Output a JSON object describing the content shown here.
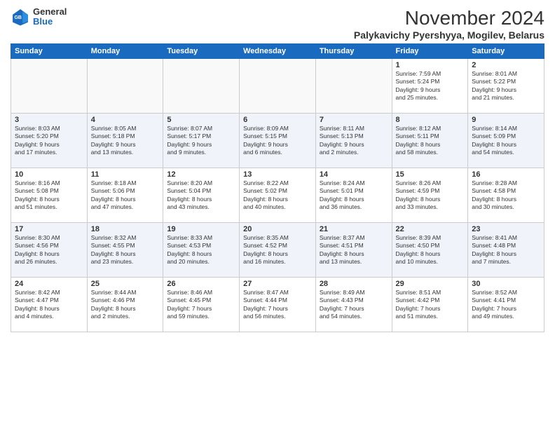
{
  "logo": {
    "general": "General",
    "blue": "Blue"
  },
  "header": {
    "title": "November 2024",
    "subtitle": "Palykavichy Pyershyya, Mogilev, Belarus"
  },
  "weekdays": [
    "Sunday",
    "Monday",
    "Tuesday",
    "Wednesday",
    "Thursday",
    "Friday",
    "Saturday"
  ],
  "weeks": [
    {
      "days": [
        {
          "num": "",
          "info": ""
        },
        {
          "num": "",
          "info": ""
        },
        {
          "num": "",
          "info": ""
        },
        {
          "num": "",
          "info": ""
        },
        {
          "num": "",
          "info": ""
        },
        {
          "num": "1",
          "info": "Sunrise: 7:59 AM\nSunset: 5:24 PM\nDaylight: 9 hours\nand 25 minutes."
        },
        {
          "num": "2",
          "info": "Sunrise: 8:01 AM\nSunset: 5:22 PM\nDaylight: 9 hours\nand 21 minutes."
        }
      ]
    },
    {
      "days": [
        {
          "num": "3",
          "info": "Sunrise: 8:03 AM\nSunset: 5:20 PM\nDaylight: 9 hours\nand 17 minutes."
        },
        {
          "num": "4",
          "info": "Sunrise: 8:05 AM\nSunset: 5:18 PM\nDaylight: 9 hours\nand 13 minutes."
        },
        {
          "num": "5",
          "info": "Sunrise: 8:07 AM\nSunset: 5:17 PM\nDaylight: 9 hours\nand 9 minutes."
        },
        {
          "num": "6",
          "info": "Sunrise: 8:09 AM\nSunset: 5:15 PM\nDaylight: 9 hours\nand 6 minutes."
        },
        {
          "num": "7",
          "info": "Sunrise: 8:11 AM\nSunset: 5:13 PM\nDaylight: 9 hours\nand 2 minutes."
        },
        {
          "num": "8",
          "info": "Sunrise: 8:12 AM\nSunset: 5:11 PM\nDaylight: 8 hours\nand 58 minutes."
        },
        {
          "num": "9",
          "info": "Sunrise: 8:14 AM\nSunset: 5:09 PM\nDaylight: 8 hours\nand 54 minutes."
        }
      ]
    },
    {
      "days": [
        {
          "num": "10",
          "info": "Sunrise: 8:16 AM\nSunset: 5:08 PM\nDaylight: 8 hours\nand 51 minutes."
        },
        {
          "num": "11",
          "info": "Sunrise: 8:18 AM\nSunset: 5:06 PM\nDaylight: 8 hours\nand 47 minutes."
        },
        {
          "num": "12",
          "info": "Sunrise: 8:20 AM\nSunset: 5:04 PM\nDaylight: 8 hours\nand 43 minutes."
        },
        {
          "num": "13",
          "info": "Sunrise: 8:22 AM\nSunset: 5:02 PM\nDaylight: 8 hours\nand 40 minutes."
        },
        {
          "num": "14",
          "info": "Sunrise: 8:24 AM\nSunset: 5:01 PM\nDaylight: 8 hours\nand 36 minutes."
        },
        {
          "num": "15",
          "info": "Sunrise: 8:26 AM\nSunset: 4:59 PM\nDaylight: 8 hours\nand 33 minutes."
        },
        {
          "num": "16",
          "info": "Sunrise: 8:28 AM\nSunset: 4:58 PM\nDaylight: 8 hours\nand 30 minutes."
        }
      ]
    },
    {
      "days": [
        {
          "num": "17",
          "info": "Sunrise: 8:30 AM\nSunset: 4:56 PM\nDaylight: 8 hours\nand 26 minutes."
        },
        {
          "num": "18",
          "info": "Sunrise: 8:32 AM\nSunset: 4:55 PM\nDaylight: 8 hours\nand 23 minutes."
        },
        {
          "num": "19",
          "info": "Sunrise: 8:33 AM\nSunset: 4:53 PM\nDaylight: 8 hours\nand 20 minutes."
        },
        {
          "num": "20",
          "info": "Sunrise: 8:35 AM\nSunset: 4:52 PM\nDaylight: 8 hours\nand 16 minutes."
        },
        {
          "num": "21",
          "info": "Sunrise: 8:37 AM\nSunset: 4:51 PM\nDaylight: 8 hours\nand 13 minutes."
        },
        {
          "num": "22",
          "info": "Sunrise: 8:39 AM\nSunset: 4:50 PM\nDaylight: 8 hours\nand 10 minutes."
        },
        {
          "num": "23",
          "info": "Sunrise: 8:41 AM\nSunset: 4:48 PM\nDaylight: 8 hours\nand 7 minutes."
        }
      ]
    },
    {
      "days": [
        {
          "num": "24",
          "info": "Sunrise: 8:42 AM\nSunset: 4:47 PM\nDaylight: 8 hours\nand 4 minutes."
        },
        {
          "num": "25",
          "info": "Sunrise: 8:44 AM\nSunset: 4:46 PM\nDaylight: 8 hours\nand 2 minutes."
        },
        {
          "num": "26",
          "info": "Sunrise: 8:46 AM\nSunset: 4:45 PM\nDaylight: 7 hours\nand 59 minutes."
        },
        {
          "num": "27",
          "info": "Sunrise: 8:47 AM\nSunset: 4:44 PM\nDaylight: 7 hours\nand 56 minutes."
        },
        {
          "num": "28",
          "info": "Sunrise: 8:49 AM\nSunset: 4:43 PM\nDaylight: 7 hours\nand 54 minutes."
        },
        {
          "num": "29",
          "info": "Sunrise: 8:51 AM\nSunset: 4:42 PM\nDaylight: 7 hours\nand 51 minutes."
        },
        {
          "num": "30",
          "info": "Sunrise: 8:52 AM\nSunset: 4:41 PM\nDaylight: 7 hours\nand 49 minutes."
        }
      ]
    }
  ]
}
